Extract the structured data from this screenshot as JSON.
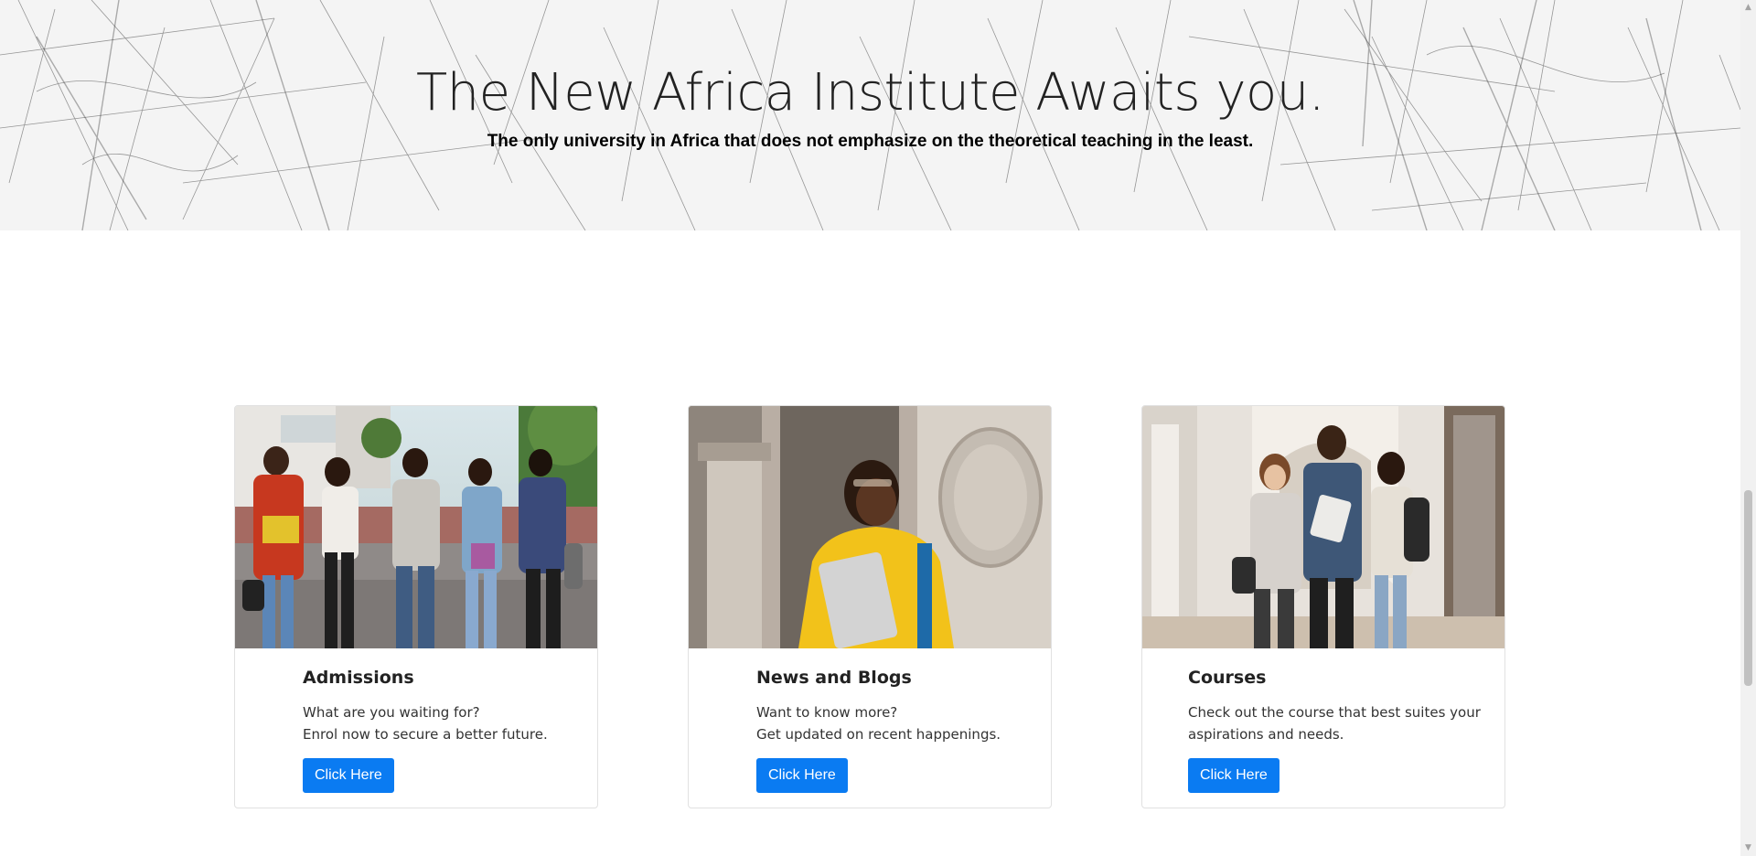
{
  "hero": {
    "title": "The New Africa Institute Awaits you.",
    "subtitle": "The only university in Africa that does not emphasize on the theoretical teaching in the least."
  },
  "cards": [
    {
      "title": "Admissions",
      "text_line1": "What are you waiting for?",
      "text_line2": "Enrol now to secure a better future.",
      "button_label": "Click Here"
    },
    {
      "title": "News and Blogs",
      "text_line1": "Want to know more?",
      "text_line2": "Get updated on recent happenings.",
      "button_label": "Click Here"
    },
    {
      "title": "Courses",
      "text_line1": "Check out the course that best suites your",
      "text_line2": "aspirations and needs.",
      "button_label": "Click Here"
    }
  ],
  "colors": {
    "button": "#0a7bf2",
    "hero_background": "#f4f4f4"
  },
  "scrollbar": {
    "up_icon": "scroll-up-arrow-icon",
    "down_icon": "scroll-down-arrow-icon"
  }
}
